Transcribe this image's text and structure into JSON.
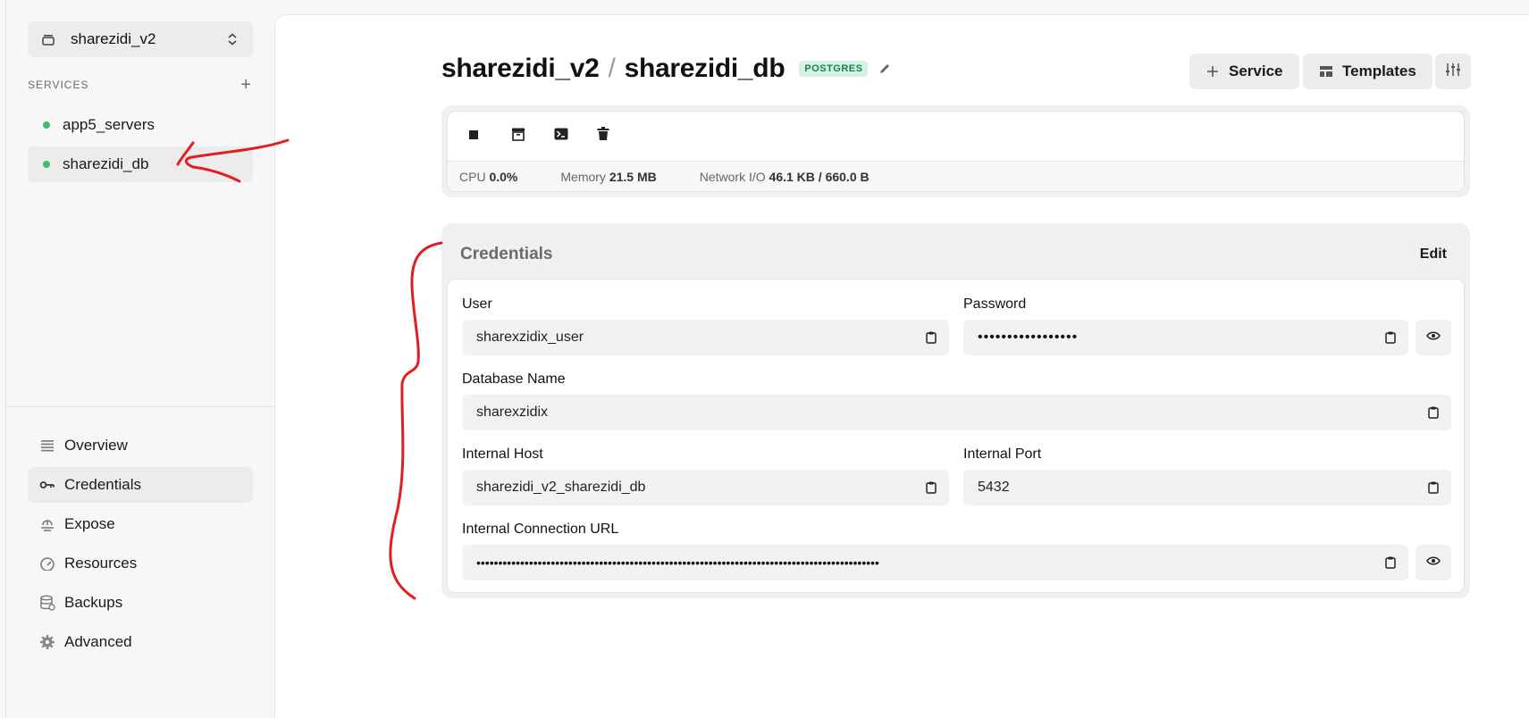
{
  "project": {
    "name": "sharezidi_v2"
  },
  "services": {
    "heading": "SERVICES",
    "items": [
      {
        "name": "app5_servers"
      },
      {
        "name": "sharezidi_db"
      }
    ]
  },
  "nav": [
    {
      "label": "Overview",
      "icon": "list-icon"
    },
    {
      "label": "Credentials",
      "icon": "key-icon"
    },
    {
      "label": "Expose",
      "icon": "globe-icon"
    },
    {
      "label": "Resources",
      "icon": "gauge-icon"
    },
    {
      "label": "Backups",
      "icon": "database-icon"
    },
    {
      "label": "Advanced",
      "icon": "gear-icon"
    }
  ],
  "header": {
    "project": "sharezidi_v2",
    "separator": "/",
    "service": "sharezidi_db",
    "badge": "POSTGRES",
    "service_button": "Service",
    "templates_button": "Templates"
  },
  "metrics": {
    "cpu_label": "CPU",
    "cpu_value": "0.0%",
    "memory_label": "Memory",
    "memory_value": "21.5 MB",
    "network_label": "Network I/O",
    "network_value": "46.1 KB / 660.0 B"
  },
  "credentials": {
    "title": "Credentials",
    "edit_label": "Edit",
    "user": {
      "label": "User",
      "value": "sharexzidix_user"
    },
    "password": {
      "label": "Password",
      "value": "•••••••••••••••••"
    },
    "database": {
      "label": "Database Name",
      "value": "sharexzidix"
    },
    "host": {
      "label": "Internal Host",
      "value": "sharezidi_v2_sharezidi_db"
    },
    "port": {
      "label": "Internal Port",
      "value": "5432"
    },
    "url": {
      "label": "Internal Connection URL",
      "value": "••••••••••••••••••••••••••••••••••••••••••••••••••••••••••••••••••••••••••••••••••••••••••••"
    }
  },
  "colors": {
    "status_dot": "#3fbf6a",
    "badge_bg": "#d3f4e2",
    "badge_text": "#1a7f4b",
    "annotation": "#e02020"
  }
}
